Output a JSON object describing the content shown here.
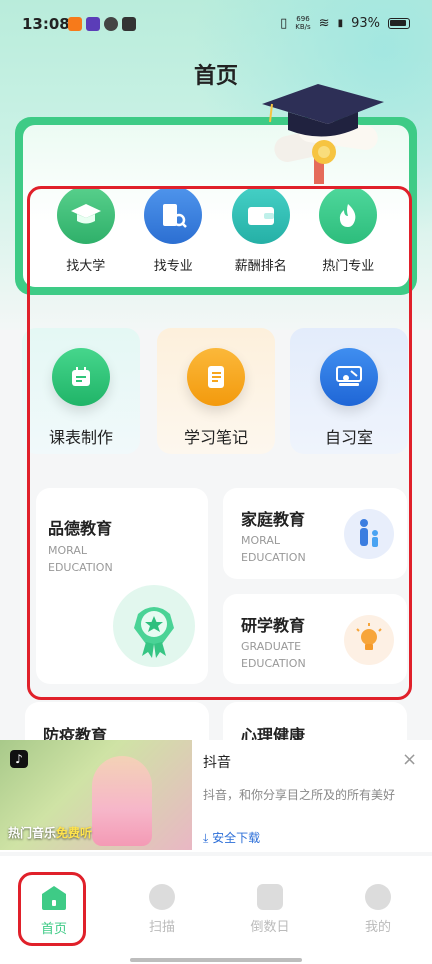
{
  "status_bar": {
    "time": "13:08",
    "net_speed_value": "696",
    "net_speed_unit": "KB/s",
    "battery": "93%"
  },
  "page_title": "首页",
  "quick_links": [
    {
      "label": "找大学",
      "icon": "graduation-cap-icon",
      "color": "#3fbf78"
    },
    {
      "label": "找专业",
      "icon": "building-search-icon",
      "color": "#3a82e0"
    },
    {
      "label": "薪酬排名",
      "icon": "wallet-icon",
      "color": "#32c2b8"
    },
    {
      "label": "热门专业",
      "icon": "flame-icon",
      "color": "#39c98d"
    }
  ],
  "features": [
    {
      "label": "课表制作",
      "icon": "calendar-icon",
      "color": "#2fc57a",
      "bg": "#e7f6f6"
    },
    {
      "label": "学习笔记",
      "icon": "notebook-icon",
      "color": "#f7a61e",
      "bg": "#fdf1e0"
    },
    {
      "label": "自习室",
      "icon": "classroom-icon",
      "color": "#2d7ae0",
      "bg": "#e6effb"
    }
  ],
  "education": {
    "moral": {
      "title": "品德教育",
      "sub": "MORAL\nEDUCATION"
    },
    "family": {
      "title": "家庭教育",
      "sub": "MORAL\nEDUCATION"
    },
    "research": {
      "title": "研学教育",
      "sub": "GRADUATE\nEDUCATION"
    },
    "epidemic": {
      "title": "防疫教育"
    },
    "mental": {
      "title": "心理健康"
    }
  },
  "ad": {
    "app_name": "抖音",
    "description": "抖音，和你分享目之所及的所有美好",
    "download": "安全下载",
    "caption_main": "热门音乐",
    "caption_highlight": "免费听",
    "close": "×"
  },
  "bottom_nav": [
    {
      "label": "首页",
      "icon": "home-icon",
      "active": true
    },
    {
      "label": "扫描",
      "icon": "scan-icon",
      "active": false
    },
    {
      "label": "倒数日",
      "icon": "countdown-icon",
      "active": false
    },
    {
      "label": "我的",
      "icon": "user-icon",
      "active": false
    }
  ],
  "colors": {
    "accent_green": "#3ecb86",
    "highlight_red": "#e0202a",
    "link_blue": "#2d6fd8"
  }
}
